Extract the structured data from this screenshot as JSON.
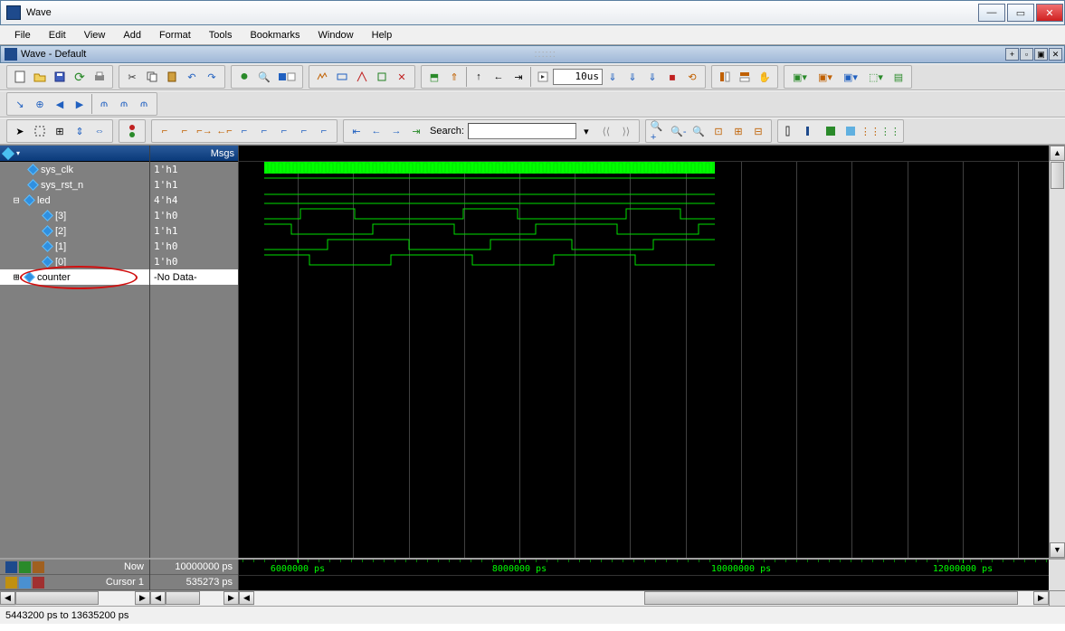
{
  "window": {
    "title": "Wave"
  },
  "menu": {
    "items": [
      "File",
      "Edit",
      "View",
      "Add",
      "Format",
      "Tools",
      "Bookmarks",
      "Window",
      "Help"
    ]
  },
  "subwindow": {
    "title": "Wave - Default"
  },
  "toolbar": {
    "time_value": "10us",
    "search_label": "Search:"
  },
  "columns": {
    "signals_hdr": "",
    "msgs_hdr": "Msgs"
  },
  "signals": [
    {
      "name": "sys_clk",
      "indent": 1,
      "expand": "",
      "value": "1'h1"
    },
    {
      "name": "sys_rst_n",
      "indent": 1,
      "expand": "",
      "value": "1'h1"
    },
    {
      "name": "led",
      "indent": 0,
      "expand": "−",
      "value": "4'h4"
    },
    {
      "name": "[3]",
      "indent": 2,
      "expand": "",
      "value": "1'h0"
    },
    {
      "name": "[2]",
      "indent": 2,
      "expand": "",
      "value": "1'h1"
    },
    {
      "name": "[1]",
      "indent": 2,
      "expand": "",
      "value": "1'h0"
    },
    {
      "name": "[0]",
      "indent": 2,
      "expand": "",
      "value": "1'h0"
    },
    {
      "name": "counter",
      "indent": 0,
      "expand": "+",
      "value": "-No Data-",
      "selected": true,
      "ellipse": true
    }
  ],
  "cursors": {
    "now_label": "Now",
    "now_value": "10000000 ps",
    "cursor_label": "Cursor 1",
    "cursor_value": "535273 ps"
  },
  "timeline": {
    "labels": [
      {
        "pos": 65,
        "text": "6000000 ps"
      },
      {
        "pos": 310,
        "text": "8000000 ps"
      },
      {
        "pos": 555,
        "text": "10000000 ps"
      },
      {
        "pos": 800,
        "text": "12000000 ps"
      }
    ]
  },
  "status": {
    "range": "5443200 ps to 13635200 ps"
  }
}
